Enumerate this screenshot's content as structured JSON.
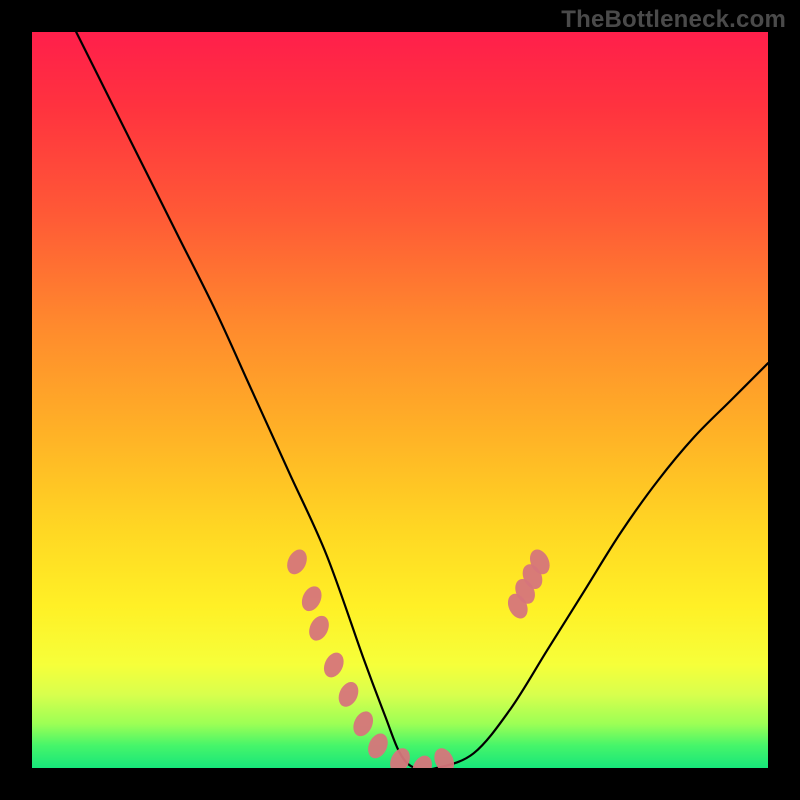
{
  "watermark": "TheBottleneck.com",
  "chart_data": {
    "type": "line",
    "title": "",
    "xlabel": "",
    "ylabel": "",
    "xlim": [
      0,
      100
    ],
    "ylim": [
      0,
      100
    ],
    "grid": false,
    "legend": false,
    "series": [
      {
        "name": "curve",
        "color": "#000000",
        "x": [
          6,
          10,
          15,
          20,
          25,
          30,
          35,
          40,
          45,
          48,
          50,
          52,
          55,
          60,
          65,
          70,
          75,
          80,
          85,
          90,
          95,
          100
        ],
        "y": [
          100,
          92,
          82,
          72,
          62,
          51,
          40,
          29,
          15,
          7,
          2,
          0,
          0,
          2,
          8,
          16,
          24,
          32,
          39,
          45,
          50,
          55
        ]
      }
    ],
    "markers": [
      {
        "name": "left-cluster",
        "color": "#d6757b",
        "points": [
          {
            "x": 36,
            "y": 28
          },
          {
            "x": 38,
            "y": 23
          },
          {
            "x": 39,
            "y": 19
          },
          {
            "x": 41,
            "y": 14
          },
          {
            "x": 43,
            "y": 10
          },
          {
            "x": 45,
            "y": 6
          },
          {
            "x": 47,
            "y": 3
          },
          {
            "x": 50,
            "y": 1
          },
          {
            "x": 53,
            "y": 0
          },
          {
            "x": 56,
            "y": 1
          }
        ]
      },
      {
        "name": "right-cluster",
        "color": "#d6757b",
        "points": [
          {
            "x": 66,
            "y": 22
          },
          {
            "x": 67,
            "y": 24
          },
          {
            "x": 68,
            "y": 26
          },
          {
            "x": 69,
            "y": 28
          }
        ]
      }
    ],
    "background_gradient": {
      "type": "vertical",
      "stops": [
        {
          "pos": 0,
          "color": "#ff1f4b"
        },
        {
          "pos": 25,
          "color": "#ff5a36"
        },
        {
          "pos": 55,
          "color": "#ffb326"
        },
        {
          "pos": 78,
          "color": "#fff026"
        },
        {
          "pos": 94,
          "color": "#9cff55"
        },
        {
          "pos": 100,
          "color": "#17e67a"
        }
      ]
    }
  }
}
